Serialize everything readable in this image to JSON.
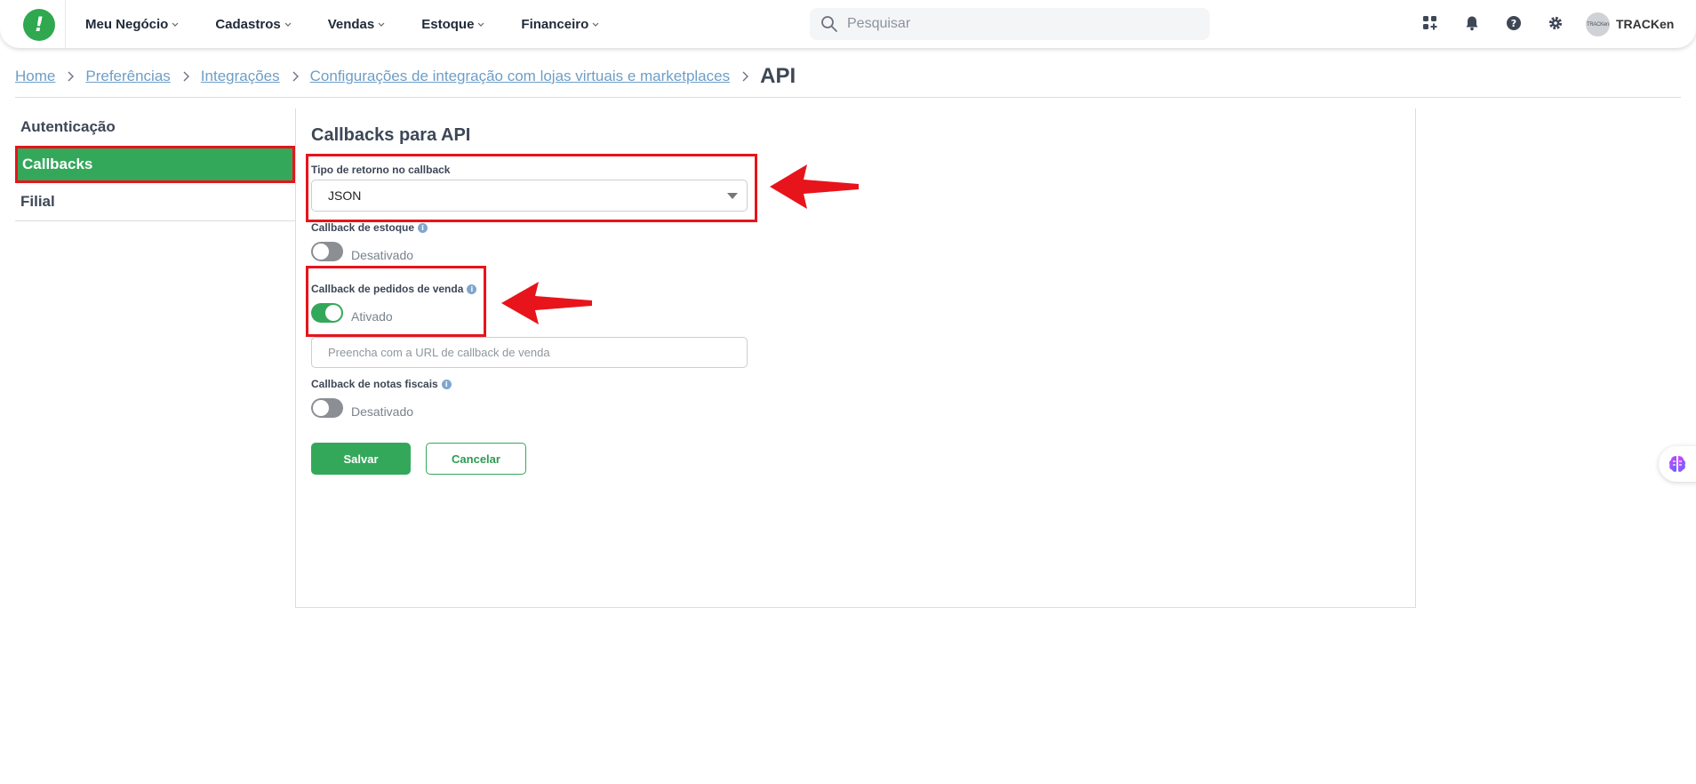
{
  "app": {
    "logo_glyph": "!",
    "brand_color": "#2fa84f",
    "accent_color": "#34a85a",
    "annotation_color": "#e8141b"
  },
  "nav": {
    "items": [
      {
        "label": "Meu Negócio"
      },
      {
        "label": "Cadastros"
      },
      {
        "label": "Vendas"
      },
      {
        "label": "Estoque"
      },
      {
        "label": "Financeiro"
      }
    ]
  },
  "search": {
    "placeholder": "Pesquisar",
    "icon": "search-icon"
  },
  "toolbar_icons": [
    "apps-icon",
    "bell-icon",
    "help-icon",
    "gear-icon"
  ],
  "user": {
    "avatar_text": "TRACKen",
    "name": "TRACKen"
  },
  "breadcrumb": {
    "links": [
      "Home",
      "Preferências",
      "Integrações",
      "Configurações de integração com lojas virtuais e marketplaces"
    ],
    "current": "API"
  },
  "side_menu": {
    "items": [
      {
        "label": "Autenticação",
        "active": false
      },
      {
        "label": "Callbacks",
        "active": true
      },
      {
        "label": "Filial",
        "active": false
      }
    ]
  },
  "panel": {
    "title": "Callbacks para API",
    "return_type": {
      "label": "Tipo de retorno no callback",
      "value": "JSON"
    },
    "stock_callback": {
      "label": "Callback de estoque",
      "state_text": "Desativado",
      "enabled": false
    },
    "orders_callback": {
      "label": "Callback de pedidos de venda",
      "state_text": "Ativado",
      "enabled": true,
      "url_placeholder": "Preencha com a URL de callback de venda"
    },
    "invoice_callback": {
      "label": "Callback de notas fiscais",
      "state_text": "Desativado",
      "enabled": false
    },
    "save_label": "Salvar",
    "cancel_label": "Cancelar"
  },
  "floating_widget": {
    "icon": "brain-icon"
  }
}
